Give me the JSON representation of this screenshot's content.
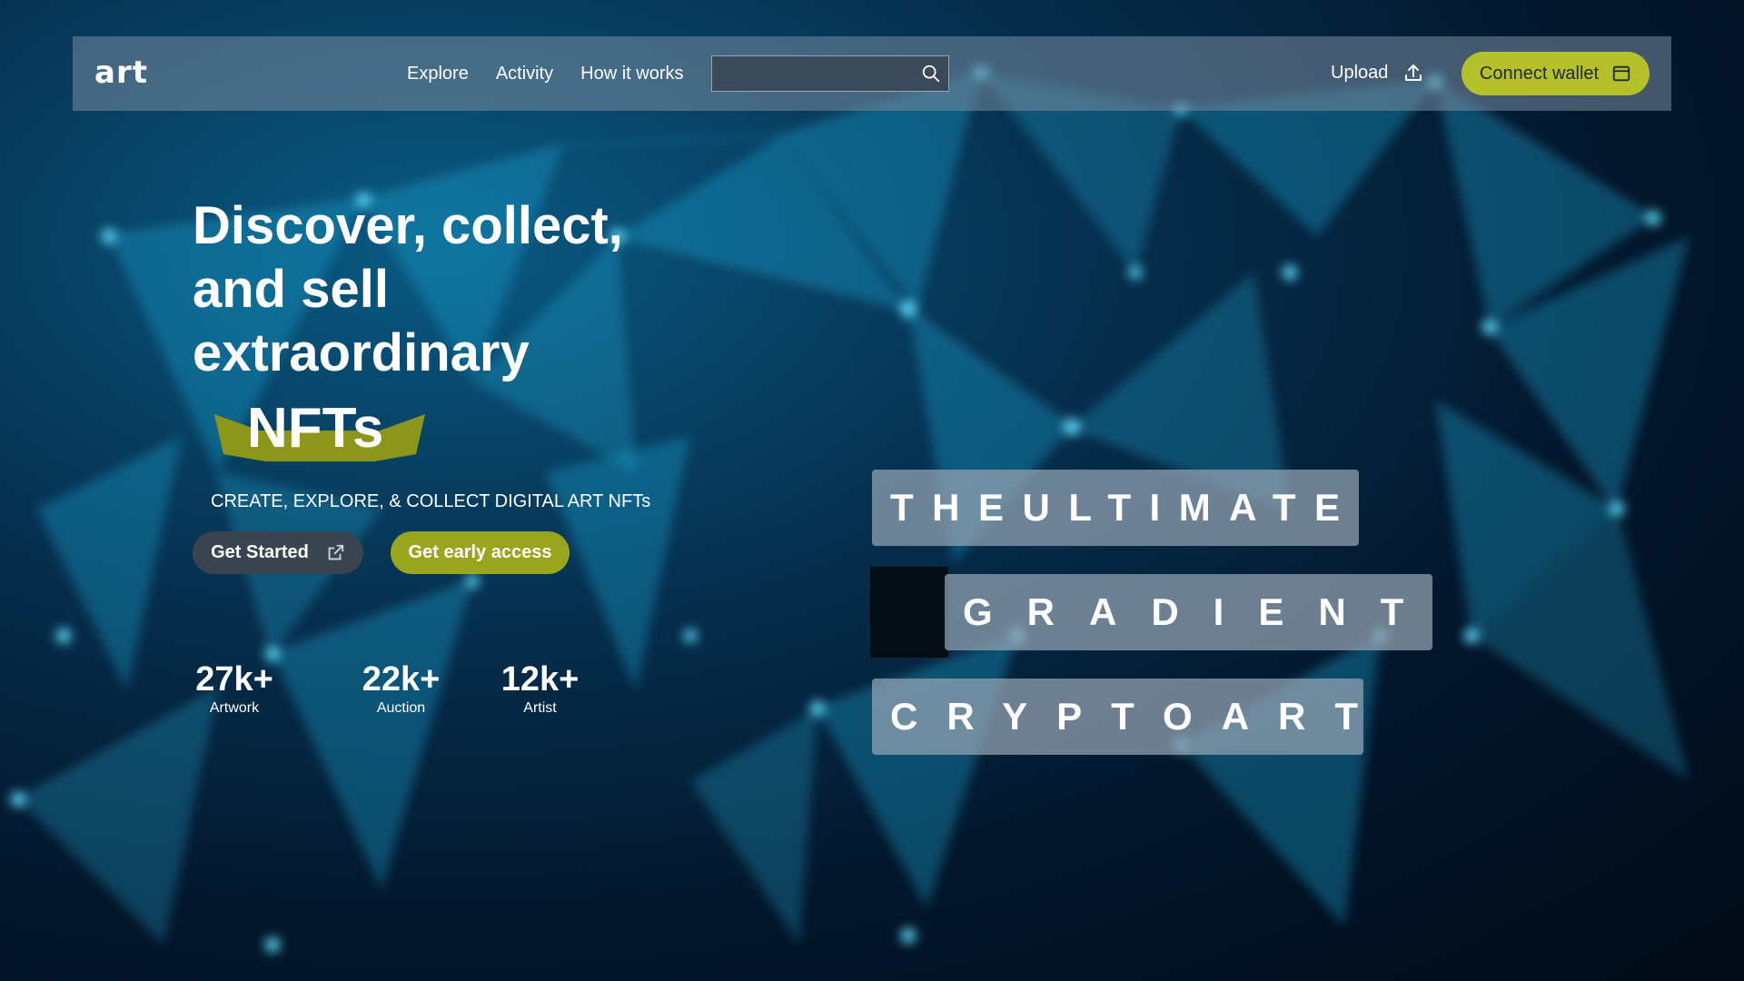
{
  "brand": {
    "logo": "art"
  },
  "nav": {
    "links": [
      "Explore",
      "Activity",
      "How it works"
    ],
    "search_placeholder": "",
    "upload_label": "Upload",
    "connect_label": "Connect wallet"
  },
  "hero": {
    "title": "Discover, collect, and sell extraordinary",
    "highlight": "NFTs",
    "subtitle": "CREATE, EXPLORE, & COLLECT DIGITAL ART NFTs",
    "cta_primary": "Get Started",
    "cta_secondary": "Get early access"
  },
  "stats": [
    {
      "value": "27k+",
      "label": "Artwork"
    },
    {
      "value": "22k+",
      "label": "Auction"
    },
    {
      "value": "12k+",
      "label": "Artist"
    }
  ],
  "panels": [
    "THEULTIMATE",
    "GRADIENT",
    "CRYPTOART"
  ],
  "colors": {
    "accent": "#b6c02a",
    "accent_dark": "#9aa51e",
    "background": "#03172c",
    "navbar": "#7f8ea0"
  },
  "icons": {
    "search": "search-icon",
    "upload": "upload-icon",
    "wallet": "wallet-icon",
    "external": "external-link-icon"
  }
}
